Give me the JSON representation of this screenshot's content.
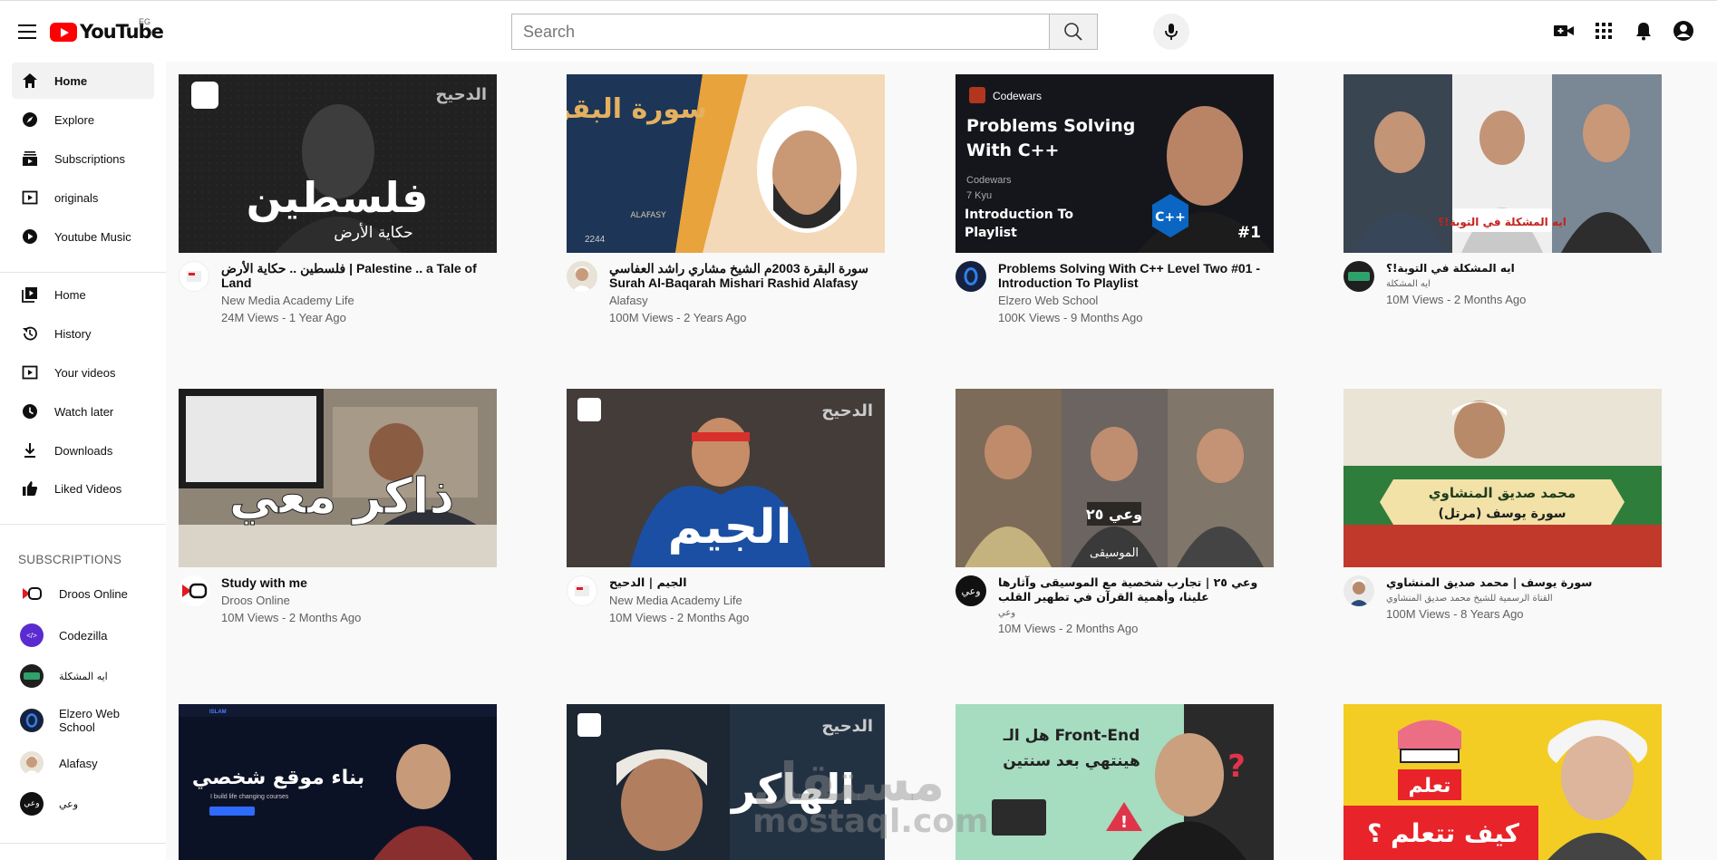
{
  "app": {
    "logo_text": "YouTube",
    "region": "EG",
    "brand_color": "#ff0000"
  },
  "search": {
    "placeholder": "Search"
  },
  "icons": {
    "menu": "hamburger-menu-icon",
    "search": "magnifier-icon",
    "mic": "microphone-icon",
    "create": "video-camera-plus-icon",
    "apps": "grid-apps-icon",
    "notifications": "bell-icon",
    "account": "user-avatar-icon"
  },
  "sidebar": {
    "primary": [
      {
        "label": "Home",
        "icon": "home-icon",
        "active": true
      },
      {
        "label": "Explore",
        "icon": "compass-icon"
      },
      {
        "label": "Subscriptions",
        "icon": "subscriptions-icon"
      },
      {
        "label": "originals",
        "icon": "play-square-icon"
      },
      {
        "label": "Youtube Music",
        "icon": "music-play-icon"
      }
    ],
    "library": [
      {
        "label": "Home",
        "icon": "library-icon"
      },
      {
        "label": "History",
        "icon": "history-icon"
      },
      {
        "label": "Your videos",
        "icon": "your-videos-icon"
      },
      {
        "label": "Watch later",
        "icon": "clock-icon"
      },
      {
        "label": "Downloads",
        "icon": "download-icon"
      },
      {
        "label": "Liked Videos",
        "icon": "thumbs-up-icon"
      }
    ],
    "subscriptions_heading": "SUBSCRIPTIONS",
    "subscriptions": [
      {
        "label": "Droos Online"
      },
      {
        "label": "Codezilla"
      },
      {
        "label": "ايه المشكلة"
      },
      {
        "label": "Elzero Web School"
      },
      {
        "label": "Alafasy"
      },
      {
        "label": "وعي"
      }
    ]
  },
  "videos": [
    {
      "title": "فلسطين .. حكاية الأرض | Palestine .. a Tale of Land",
      "channel": "New Media Academy Life",
      "stats": "24M Views - 1 Year Ago",
      "thumb_text": "فلسطين",
      "thumb_sub": "حكاية الأرض"
    },
    {
      "title": "سورة البقرة 2003م الشيخ مشاري راشد العفاسي Surah Al-Baqarah Mishari Rashid Alafasy",
      "channel": "Alafasy",
      "stats": "100M Views - 2 Years Ago",
      "thumb_text": "سورة البقرة",
      "thumb_sub": "ALAFASY",
      "thumb_num": "2244"
    },
    {
      "title": "Problems Solving With C++ Level Two #01 - Introduction To Playlist",
      "channel": "Elzero Web School",
      "stats": "100K Views - 9 Months Ago",
      "thumb_brand": "Codewars",
      "thumb_text": "Problems Solving With C++",
      "thumb_kyu": "7 Kyu",
      "thumb_sub": "Introduction To Playlist",
      "thumb_num": "#1"
    },
    {
      "title": "ايه المشكلة في التوبة!؟",
      "channel": "ايه المشكلة",
      "stats": "10M Views - 2 Months Ago",
      "thumb_text": "ايه المشكلة في التوبة!؟"
    },
    {
      "title": "Study with me",
      "channel": "Droos Online",
      "stats": "10M Views - 2 Months Ago",
      "thumb_text": "ذاكر معي"
    },
    {
      "title": "الجيم | الدحيح",
      "channel": "New Media Academy Life",
      "stats": "10M Views - 2 Months Ago",
      "thumb_text": "الجيم"
    },
    {
      "title": "وعي ٢٥ | تجارب شخصية مع الموسيقى وآثارها علينا، وأهمية القرآن في تطهير القلب",
      "channel": "وعي",
      "stats": "10M Views - 2 Months Ago",
      "thumb_text": "وعي ٢٥",
      "thumb_sub": "الموسيقى"
    },
    {
      "title": "سورة يوسف | محمد صديق المنشاوي",
      "channel": "القناة الرسمية للشيخ محمد صديق المنشاوي",
      "stats": "100M Views - 8 Years Ago",
      "thumb_text": "محمد صديق المنشاوي",
      "thumb_sub": "سورة يوسف (مرتل)"
    },
    {
      "title": "",
      "channel": "",
      "stats": "",
      "thumb_text": "بناء موقع شخصي",
      "thumb_sub": "I build life changing courses",
      "thumb_brand": "ISLAM"
    },
    {
      "title": "",
      "channel": "",
      "stats": "",
      "thumb_text": "الهاكر"
    },
    {
      "title": "",
      "channel": "",
      "stats": "",
      "thumb_text": "هل الـ Front-End",
      "thumb_sub": "هينتهي بعد سنتين"
    },
    {
      "title": "",
      "channel": "",
      "stats": "",
      "thumb_text": "تعلم",
      "thumb_sub": "كيف تتعلم ؟"
    }
  ],
  "watermark": {
    "text": "مستقل",
    "sub": "mostaql.com"
  }
}
